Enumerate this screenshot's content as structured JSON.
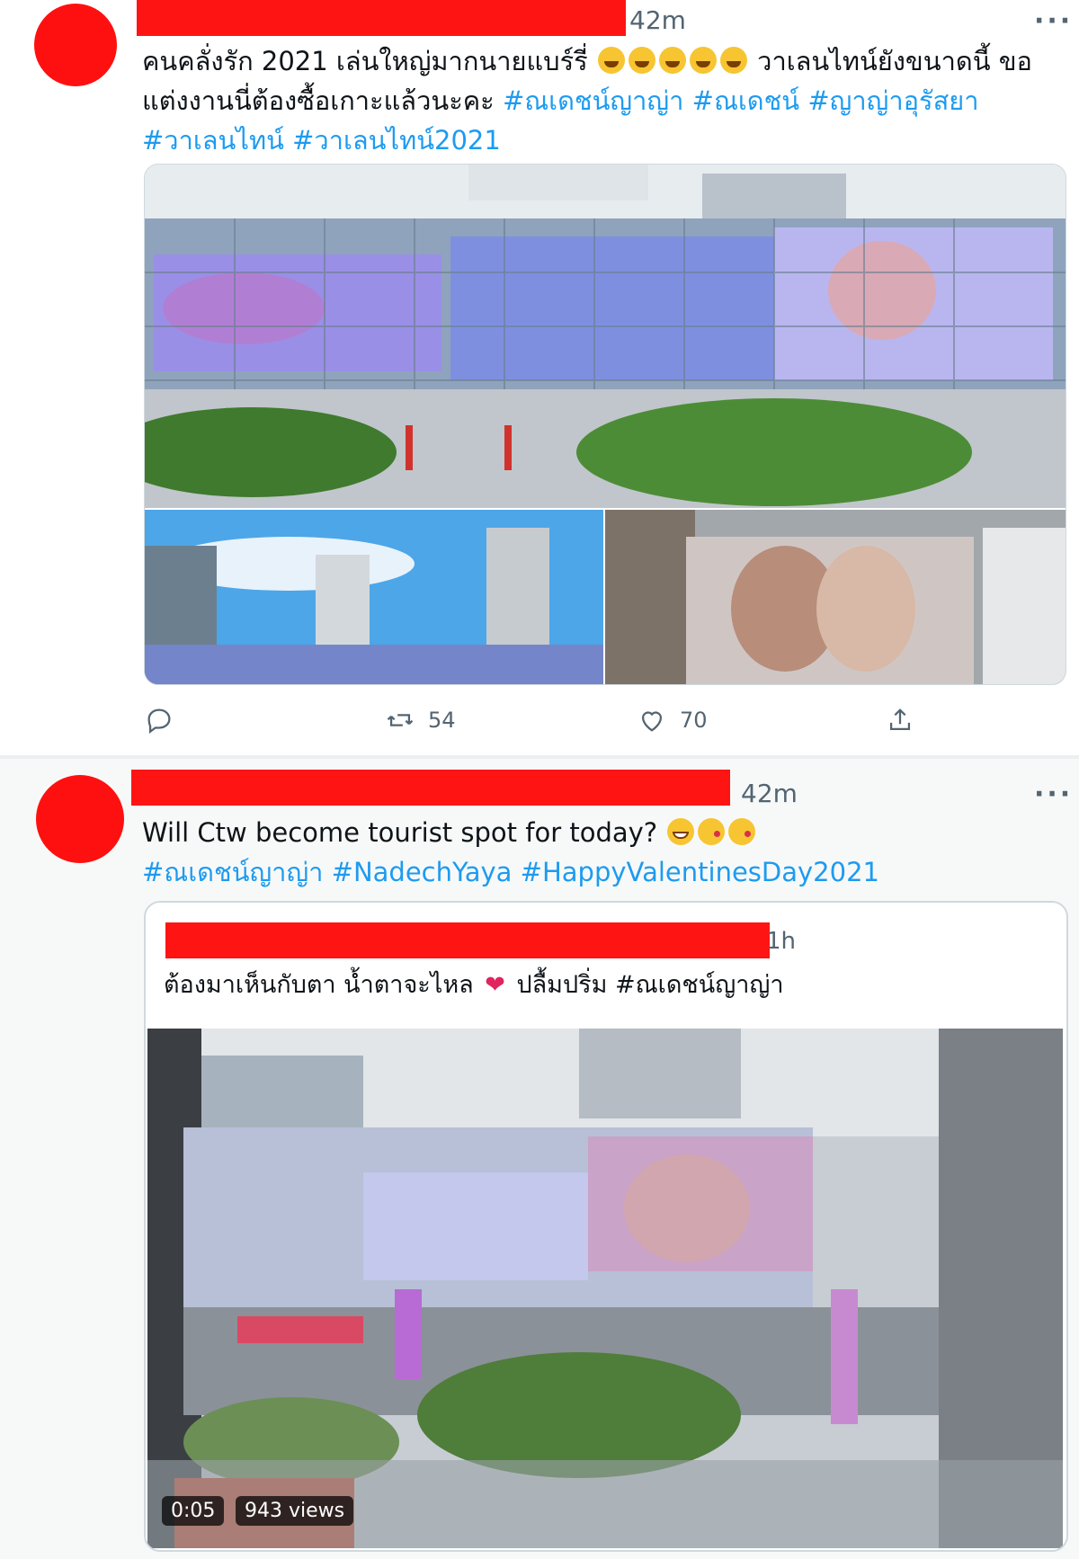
{
  "tweet1": {
    "time": "42m",
    "more_label": "···",
    "text_part1": "คนคลั่งรัก 2021 เล่นใหญ่มากนายแบร์รี่ ",
    "text_part2": " วาเลนไทน์ยังขนาดนี้ ขอแต่งงานนี่ต้องซื้อเกาะแล้วนะคะ ",
    "hashtags": [
      "#ณเดชน์ญาญ่า",
      "#ณเดชน์",
      "#ญาญ่าอุรัสยา",
      "#วาเลนไทน์",
      "#วาเลนไทน์2021"
    ],
    "emojis": [
      "laughing-crying-face",
      "laughing-crying-face",
      "laughing-crying-face",
      "laughing-crying-face",
      "laughing-crying-face"
    ],
    "actions": {
      "retweet_count": "54",
      "like_count": "70"
    }
  },
  "tweet2": {
    "time": "42m",
    "more_label": "···",
    "text": "Will Ctw become tourist spot for today? ",
    "emojis": [
      "grinning-face",
      "kissing-heart-face",
      "kissing-heart-face"
    ],
    "hashtags": [
      "#ณเดชน์ญาญ่า",
      "#NadechYaya",
      "#HappyValentinesDay2021"
    ],
    "quoted": {
      "time": "1h",
      "text_part1": "ต้องมาเห็นกับตา น้ำตาจะไหล ",
      "text_part2": " ปลื้มปริ่ม ",
      "hashtag": "#ณเดชน์ญาญ่า",
      "video_time": "0:05",
      "video_views": "943 views"
    }
  },
  "colors": {
    "hashtag": "#1d9bf0",
    "redaction": "#ff1414",
    "muted": "#536471"
  }
}
